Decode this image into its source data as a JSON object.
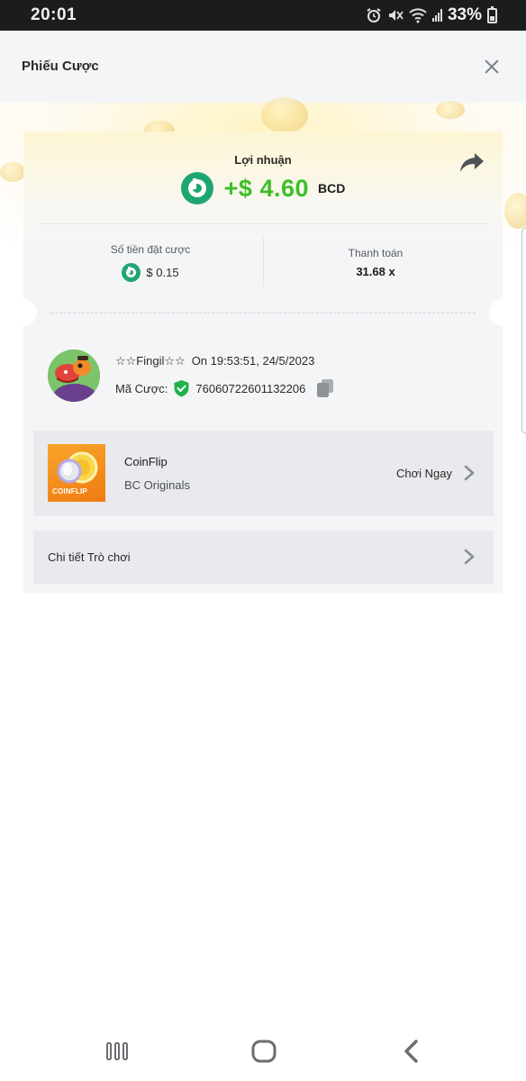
{
  "status_bar": {
    "time": "20:01",
    "battery": "33%",
    "icons": [
      "alarm-icon",
      "mute-icon",
      "wifi-icon",
      "signal-icon",
      "battery-icon"
    ]
  },
  "header": {
    "title": "Phiếu Cược",
    "close_icon": "close-icon"
  },
  "ticket": {
    "profit_label": "Lợi nhuận",
    "profit_amount": "+$ 4.60",
    "profit_currency": "BCD",
    "bet_amount_label": "Số tiền đặt cược",
    "bet_amount": "$ 0.15",
    "payout_label": "Thanh toán",
    "payout_value": "31.68 x"
  },
  "user": {
    "name": "☆☆Fingil☆☆",
    "timestamp": "On  19:53:51, 24/5/2023",
    "bet_id_label": "Mã Cược:",
    "bet_id": "76060722601132206"
  },
  "game": {
    "thumb_text": "COINFLIP",
    "name": "CoinFlip",
    "provider": "BC Originals",
    "play_label": "Chơi Ngay"
  },
  "details": {
    "label": "Chi tiết Trò chơi"
  },
  "colors": {
    "profit_green": "#3dbf2a",
    "bc_brand": "#1ea672",
    "verified_green": "#22b24c",
    "header_bg": "#f4f5f7",
    "card_bg": "#e9eaed"
  }
}
